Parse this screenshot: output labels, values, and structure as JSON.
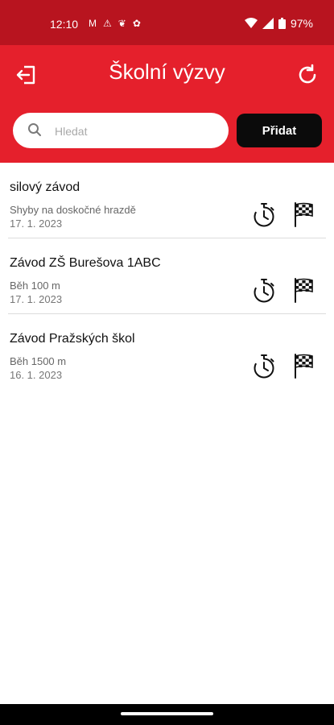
{
  "status_bar": {
    "time": "12:10",
    "left_icons": [
      "gmail-icon",
      "notification-icon",
      "leaf-icon",
      "maple-leaf-icon"
    ],
    "battery": "97%"
  },
  "header": {
    "title": "Školní výzvy",
    "logout_icon": "logout-icon",
    "refresh_icon": "refresh-icon",
    "search_placeholder": "Hledat",
    "add_button": "Přidat",
    "brand_color": "#e5202c"
  },
  "challenges": [
    {
      "title": "silový závod",
      "subtitle": "Shyby na doskočné hrazdě",
      "date": "17. 1. 2023"
    },
    {
      "title": "Závod ZŠ Burešova 1ABC",
      "subtitle": "Běh 100 m",
      "date": "17. 1. 2023"
    },
    {
      "title": "Závod Pražských škol",
      "subtitle": "Běh 1500 m",
      "date": "16. 1. 2023"
    }
  ]
}
